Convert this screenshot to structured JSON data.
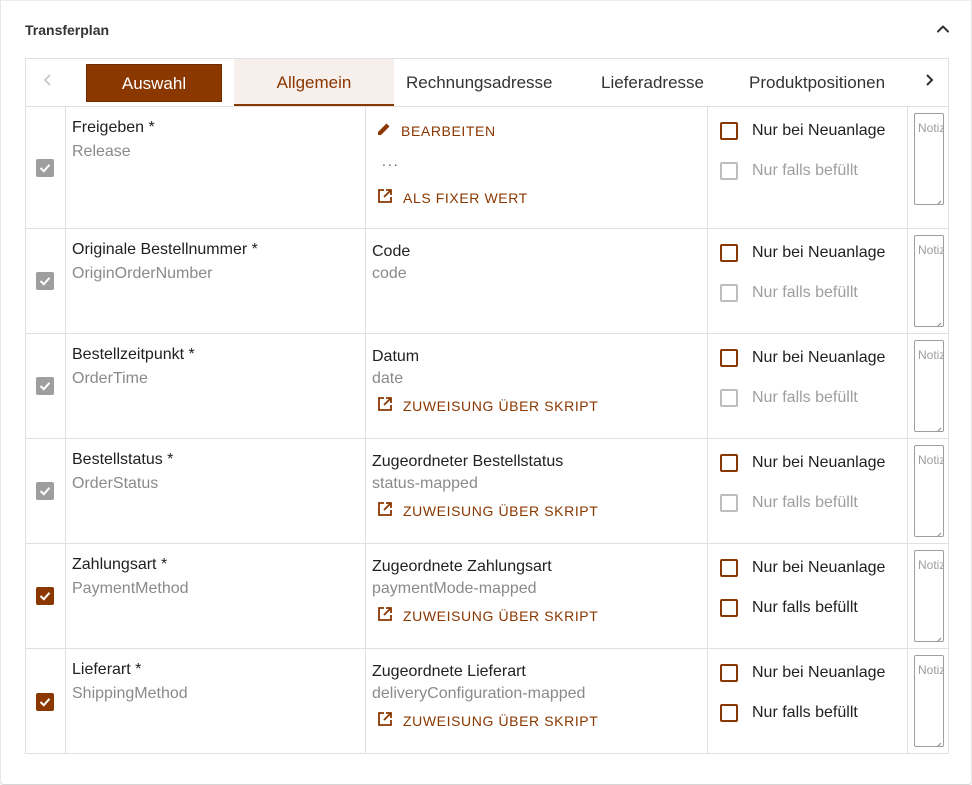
{
  "card": {
    "title": "Transferplan"
  },
  "tabs": {
    "auswahl": "Auswahl",
    "allgemein": "Allgemein",
    "rechnung": "Rechnungsadresse",
    "liefer": "Lieferadresse",
    "produkt": "Produktpositionen"
  },
  "colors": {
    "accent": "#8a3700",
    "accent_light": "#f6efeb",
    "disabled": "#9e9e9e",
    "border": "#e0e0e0"
  },
  "rows": [
    {
      "enabled_checked": true,
      "enabled_locked": true,
      "field_label": "Freigeben *",
      "field_key": "Release",
      "edit_label": "BEARBEITEN",
      "dots": "...",
      "fixed_label": "ALS FIXER WERT",
      "opt_new": "Nur bei Neuanlage",
      "opt_new_checked": false,
      "opt_filled": "Nur falls befüllt",
      "opt_filled_enabled": false,
      "note_placeholder": "Notiz"
    },
    {
      "enabled_checked": true,
      "enabled_locked": true,
      "field_label": "Originale Bestellnummer *",
      "field_key": "OriginOrderNumber",
      "source_label": "Code",
      "source_key": "code",
      "opt_new": "Nur bei Neuanlage",
      "opt_new_checked": false,
      "opt_filled": "Nur falls befüllt",
      "opt_filled_enabled": false,
      "note_placeholder": "Notiz"
    },
    {
      "enabled_checked": true,
      "enabled_locked": true,
      "field_label": "Bestellzeitpunkt *",
      "field_key": "OrderTime",
      "source_label": "Datum",
      "source_key": "date",
      "script_label": "ZUWEISUNG ÜBER SKRIPT",
      "opt_new": "Nur bei Neuanlage",
      "opt_new_checked": false,
      "opt_filled": "Nur falls befüllt",
      "opt_filled_enabled": false,
      "note_placeholder": "Notiz"
    },
    {
      "enabled_checked": true,
      "enabled_locked": true,
      "field_label": "Bestellstatus *",
      "field_key": "OrderStatus",
      "source_label": "Zugeordneter Bestellstatus",
      "source_key": "status-mapped",
      "script_label": "ZUWEISUNG ÜBER SKRIPT",
      "opt_new": "Nur bei Neuanlage",
      "opt_new_checked": false,
      "opt_filled": "Nur falls befüllt",
      "opt_filled_enabled": false,
      "note_placeholder": "Notiz"
    },
    {
      "enabled_checked": true,
      "enabled_locked": false,
      "field_label": "Zahlungsart *",
      "field_key": "PaymentMethod",
      "source_label": "Zugeordnete Zahlungsart",
      "source_key": "paymentMode-mapped",
      "script_label": "ZUWEISUNG ÜBER SKRIPT",
      "opt_new": "Nur bei Neuanlage",
      "opt_new_checked": false,
      "opt_filled": "Nur falls befüllt",
      "opt_filled_enabled": true,
      "note_placeholder": "Notiz"
    },
    {
      "enabled_checked": true,
      "enabled_locked": false,
      "field_label": "Lieferart *",
      "field_key": "ShippingMethod",
      "source_label": "Zugeordnete Lieferart",
      "source_key": "deliveryConfiguration-mapped",
      "script_label": "ZUWEISUNG ÜBER SKRIPT",
      "opt_new": "Nur bei Neuanlage",
      "opt_new_checked": false,
      "opt_filled": "Nur falls befüllt",
      "opt_filled_enabled": true,
      "note_placeholder": "Notiz"
    }
  ]
}
